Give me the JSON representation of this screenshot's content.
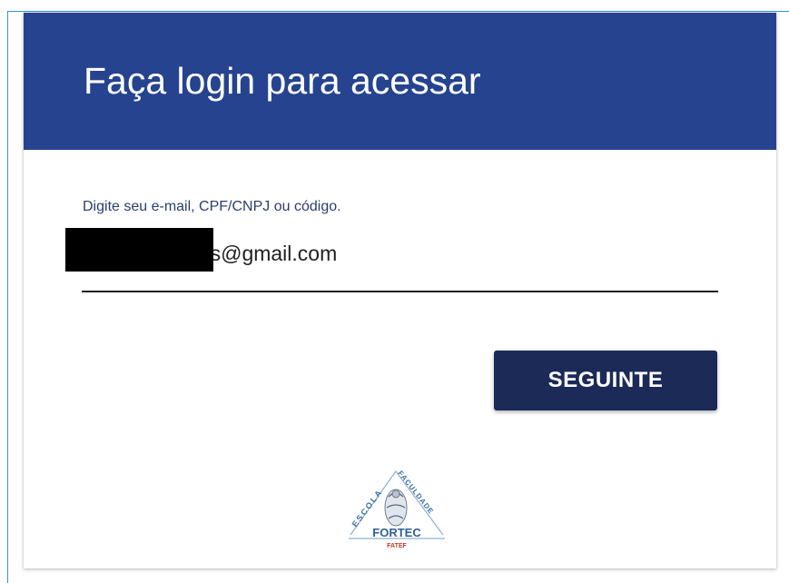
{
  "login": {
    "title": "Faça login para acessar",
    "field_label": "Digite seu e-mail, CPF/CNPJ ou código.",
    "field_value": "                    es@gmail.com",
    "next_label": "SEGUINTE"
  },
  "logo": {
    "text_left": "ESCOLA",
    "text_right": "FACULDADE",
    "text_bottom": "FORTEC",
    "text_sub": "FATEF"
  },
  "colors": {
    "header": "#25438f",
    "button": "#1b2a57",
    "frame": "#3b8fd4"
  }
}
